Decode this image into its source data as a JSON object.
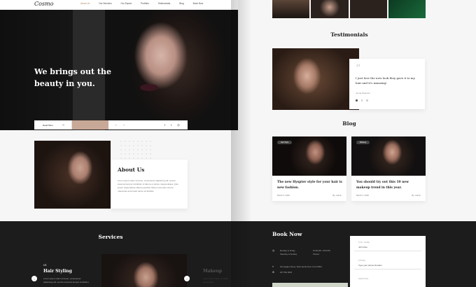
{
  "nav": {
    "logo": "Cosmo",
    "items": [
      "About Us",
      "Our Services",
      "Our Expert",
      "Portfolio",
      "Testimonials",
      "Blog",
      "Book Now"
    ],
    "active_index": 0
  },
  "hero": {
    "title": "We brings out the beauty in you.",
    "read_more": "Read More",
    "read_more_arrow": "→",
    "pager_prev": "‹",
    "pager_next": "›",
    "socials": [
      "f",
      "t",
      "◎"
    ]
  },
  "about": {
    "title": "About Us",
    "text": "Lorem ipsum dolor sit amet, consectetur adipiscing elit, sed do eiusmod tempor incididunt ut labore et dolore magna aliqua. Quis ipsum suspendisse ultrices gravida. Risus commodo viverra maecenas accumsan lacus vel facilisis."
  },
  "services": {
    "title": "Services",
    "number": "01",
    "item_title": "Hair Styling",
    "item_text": "Lorem ipsum dolor sit amet, consectetur adipiscing elit, sed do eiusmod tempor incididunt",
    "next_title": "Makeup",
    "next_text": "Lorem ipsum dolor sit amet, consectetur",
    "prev_arrow": "‹",
    "next_arrow": "›"
  },
  "testimonials": {
    "title": "Testimonials",
    "quote_mark": "“",
    "quote": "I just love the new look they gave it to my hair and it's Amazing!",
    "author": "Jenna Peterson"
  },
  "blog": {
    "title": "Blog",
    "posts": [
      {
        "tag": "Hair Style",
        "title": "The new Hyspter style for your hair is new fashion.",
        "date": "March 3, 2020",
        "author": "By: Admin"
      },
      {
        "tag": "Makeup",
        "title": "You should try out this 10 new makeup trend in this year.",
        "date": "March 3, 2020",
        "author": "By: Admin"
      }
    ]
  },
  "booknow": {
    "title": "Book Now",
    "hours_1": "Monday to Friday",
    "hours_2": "Saturday & Sunday",
    "times_1": "10:00 AM - 8:00 PM",
    "times_2": "Closed",
    "address": "101 Eagles Street, West Apollo New York 10654",
    "phone": "187 654 9632",
    "fields": [
      {
        "label": "FULL NAME",
        "value": "John Doe"
      },
      {
        "label": "PHONE",
        "value": "Type your phone Number"
      },
      {
        "label": "SERVICES",
        "value": ""
      }
    ]
  },
  "colors": {
    "accent": "#c8a896",
    "dark": "#1c1c1c",
    "light": "#f6f6f6"
  }
}
